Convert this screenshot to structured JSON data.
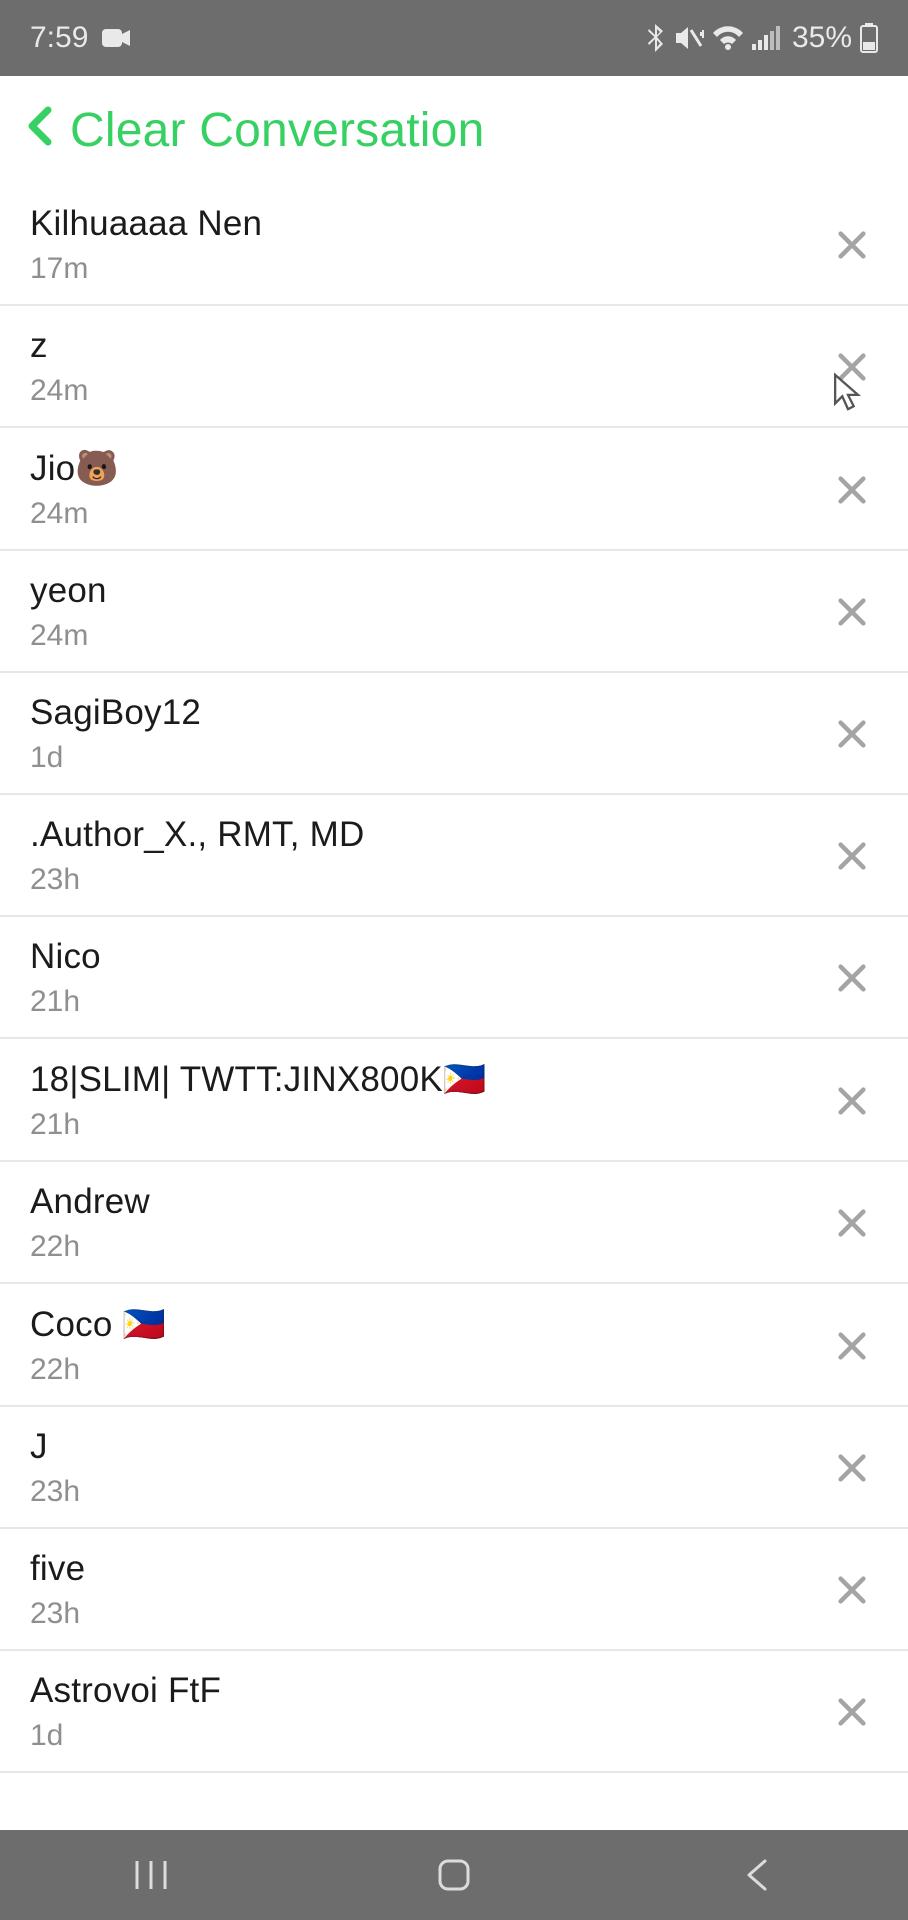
{
  "status": {
    "time": "7:59",
    "battery": "35%"
  },
  "header": {
    "title": "Clear Conversation"
  },
  "rows": [
    {
      "name": "Kilhuaaaa Nen",
      "time": "17m"
    },
    {
      "name": "z",
      "time": "24m"
    },
    {
      "name": "Jio🐻",
      "time": "24m"
    },
    {
      "name": "yeon",
      "time": "24m"
    },
    {
      "name": "SagiBoy12",
      "time": "1d"
    },
    {
      "name": ".Author_X., RMT, MD",
      "time": "23h"
    },
    {
      "name": "Nico",
      "time": "21h"
    },
    {
      "name": "18|SLIM| TWTT:JINX800K🇵🇭",
      "time": "21h"
    },
    {
      "name": "Andrew",
      "time": "22h"
    },
    {
      "name": "Coco 🇵🇭",
      "time": "22h"
    },
    {
      "name": "J",
      "time": "23h"
    },
    {
      "name": "five",
      "time": "23h"
    },
    {
      "name": "Astrovoi FtF",
      "time": "1d"
    }
  ]
}
